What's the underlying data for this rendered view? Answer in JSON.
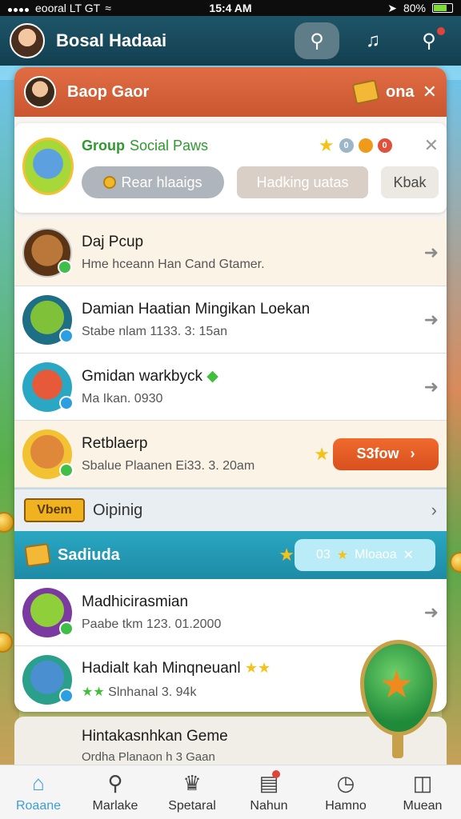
{
  "status_bar": {
    "carrier": "eooral LT GT",
    "time": "15:4 AM",
    "battery": "80%"
  },
  "header": {
    "title": "Bosal Hadaai"
  },
  "group_bar": {
    "name": "Baop Gaor",
    "status": "ona"
  },
  "social_card": {
    "title": "Group",
    "subtitle": "Social Paws",
    "badge_1": "0",
    "badge_2": "0",
    "button_primary": "Rear hlaaigs",
    "button_secondary": "Hadking uatas",
    "button_tertiary": "Kbak"
  },
  "items": [
    {
      "title": "Daj Pcup",
      "sub": "Hme hceann Han Cand Gtamer."
    },
    {
      "title": "Damian Haatian Mingikan Loekan",
      "sub": "Stabe nlam 1133. 3: 15an"
    },
    {
      "title": "Gmidan warkbyck",
      "sub": "Ma Ikan. 0930"
    },
    {
      "title": "Retblaerp",
      "sub": "Sbalue Plaanen Ei33. 3. 20am",
      "button": "S3fow"
    }
  ],
  "opening": {
    "badge": "Vbem",
    "label": "Oipinig"
  },
  "section": {
    "title": "Sadiuda",
    "pill_left": "03",
    "pill_right": "Mloaoa"
  },
  "items2": [
    {
      "title": "Madhicirasmian",
      "sub": "Paabe tkm 123. 01.2000"
    },
    {
      "title": "Hadialt kah Minqneuanl",
      "sub": "Slnhanal 3. 94k"
    }
  ],
  "bottom_game": {
    "title": "Hintakasnhkan Geme",
    "sub": "Ordha Planaon h 3 Gaan"
  },
  "nav": [
    {
      "label": "Roaane"
    },
    {
      "label": "Marlake"
    },
    {
      "label": "Spetaral"
    },
    {
      "label": "Nahun"
    },
    {
      "label": "Hamno"
    },
    {
      "label": "Muean"
    }
  ],
  "colors": {
    "header": "#1e5568",
    "group_bar": "#e06d44",
    "section_bar": "#2aa7c2",
    "accent_green": "#2e9a2e",
    "show_button": "#f06a2e"
  },
  "icons": [
    "signal-icon",
    "wifi-icon",
    "battery-icon",
    "search-icon",
    "bell-icon",
    "notification-search-icon",
    "chest-icon",
    "share-icon",
    "chevron-right-icon",
    "star-icon",
    "home-icon",
    "magnifier-icon",
    "trophy-icon",
    "inbox-icon",
    "clock-icon",
    "menu-icon"
  ]
}
